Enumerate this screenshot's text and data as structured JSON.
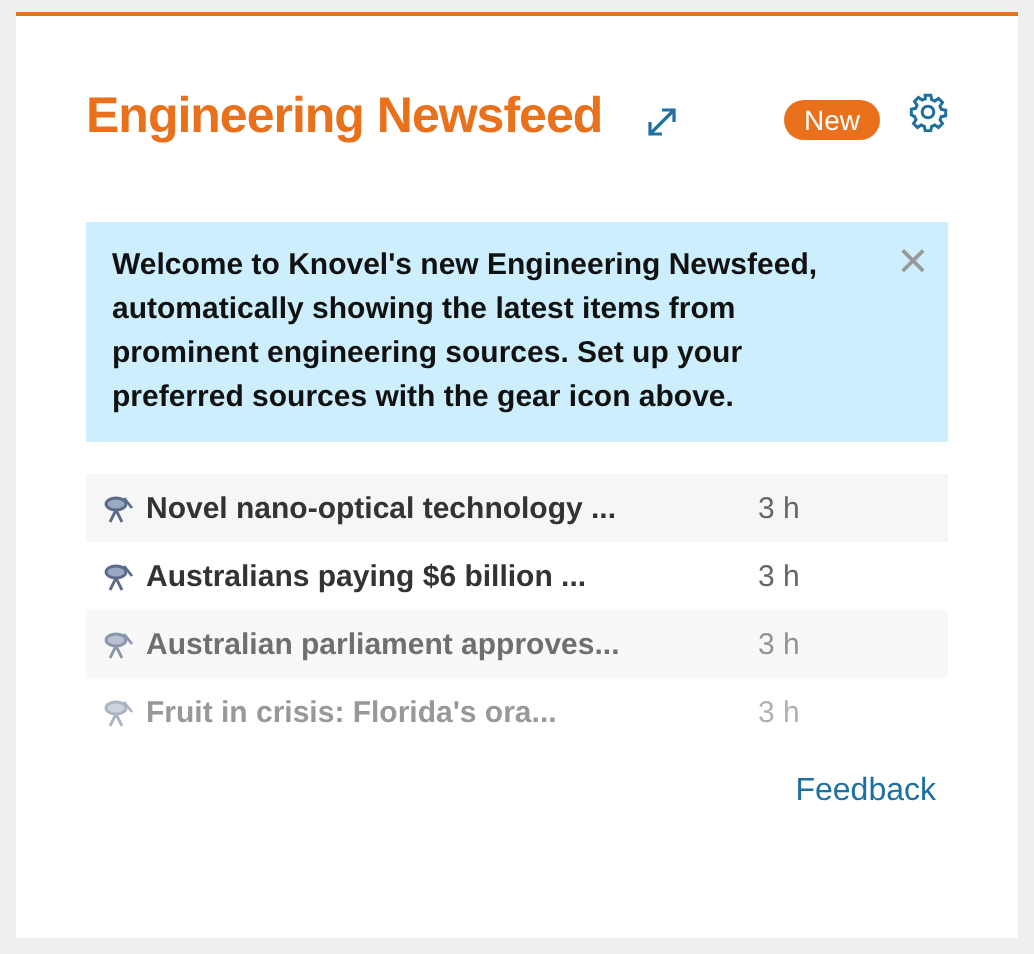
{
  "header": {
    "title": "Engineering Newsfeed",
    "badge": "New"
  },
  "notice": {
    "text": "Welcome to Knovel's new Engineering Newsfeed, automatically showing the latest items from prominent engineering sources. Set up your preferred sources with the gear icon above.",
    "close": "×"
  },
  "items": [
    {
      "title": "Novel nano-optical technology ...",
      "age": "3 h"
    },
    {
      "title": "Australians paying $6 billion ...",
      "age": "3 h"
    },
    {
      "title": "Australian parliament approves...",
      "age": "3 h"
    },
    {
      "title": "Fruit in crisis: Florida's ora...",
      "age": "3 h"
    }
  ],
  "footer": {
    "link": "Feedback"
  }
}
